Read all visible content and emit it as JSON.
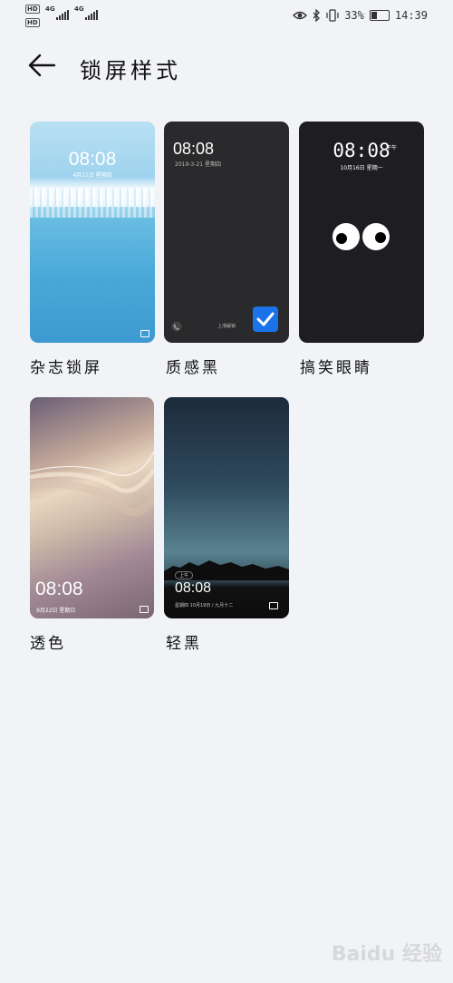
{
  "status_bar": {
    "sim1": "HD",
    "sim2": "HD",
    "net1": "4G",
    "net2": "4G",
    "battery_percent": "33%",
    "time": "14:39",
    "icons": [
      "eye-icon",
      "bluetooth-icon",
      "vibrate-icon",
      "battery-icon"
    ]
  },
  "header": {
    "back_icon": "arrow-left-icon",
    "title": "锁屏样式"
  },
  "styles": [
    {
      "label": "杂志锁屏",
      "preview_time": "08:08",
      "preview_date": "4月11日 星期四"
    },
    {
      "label": "质感黑",
      "preview_time": "08:08",
      "preview_date": "2019-3-21 星期四",
      "selected": true,
      "bottom_text": "上滑解锁"
    },
    {
      "label": "搞笑眼睛",
      "preview_time": "08:08",
      "preview_ampm": "下午",
      "preview_date": "10月16日 星期一"
    },
    {
      "label": "透色",
      "preview_time": "08:08",
      "preview_date": "9月22日 星期日"
    },
    {
      "label": "轻黑",
      "preview_time": "08:08",
      "preview_ampm": "上午",
      "preview_date": "星期四 10月19日 / 九月十二"
    }
  ],
  "watermark": "Baidu 经验"
}
